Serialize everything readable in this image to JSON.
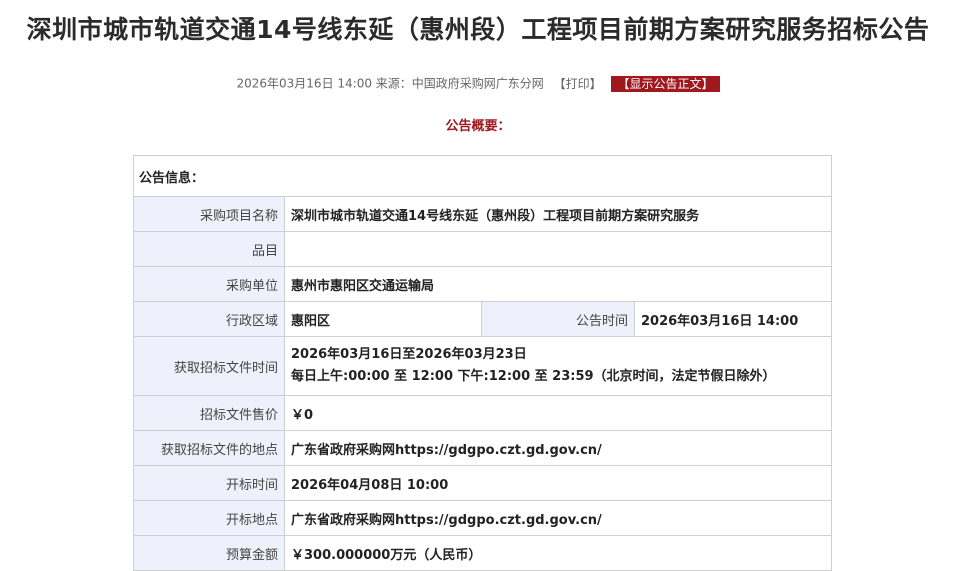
{
  "page": {
    "title": "深圳市城市轨道交通14号线东延（惠州段）工程项目前期方案研究服务招标公告"
  },
  "meta": {
    "datetime": "2026年03月16日 14:00",
    "source": "来源：中国政府采购网广东分网",
    "print_label": "【打印】",
    "show_body_label": "【显示公告正文】"
  },
  "summary": {
    "label": "公告概要："
  },
  "info": {
    "header": "公告信息：",
    "project_name": {
      "key": "采购项目名称",
      "value": "深圳市城市轨道交通14号线东延（惠州段）工程项目前期方案研究服务"
    },
    "item": {
      "key": "品目",
      "value": ""
    },
    "purchaser": {
      "key": "采购单位",
      "value": "惠州市惠阳区交通运输局"
    },
    "region": {
      "key": "行政区域",
      "value": "惠阳区"
    },
    "announce_time": {
      "key": "公告时间",
      "value": "2026年03月16日 14:00"
    },
    "doc_time": {
      "key": "获取招标文件时间",
      "line1": "2026年03月16日至2026年03月23日",
      "line2": "每日上午:00:00 至 12:00  下午:12:00 至 23:59（北京时间，法定节假日除外）"
    },
    "doc_price": {
      "key": "招标文件售价",
      "value": "￥0"
    },
    "doc_place": {
      "key": "获取招标文件的地点",
      "value": "广东省政府采购网https://gdgpo.czt.gd.gov.cn/"
    },
    "open_time": {
      "key": "开标时间",
      "value": "2026年04月08日 10:00"
    },
    "open_place": {
      "key": "开标地点",
      "value": "广东省政府采购网https://gdgpo.czt.gd.gov.cn/"
    },
    "budget": {
      "key": "预算金额",
      "value": "￥300.000000万元（人民币）"
    }
  }
}
